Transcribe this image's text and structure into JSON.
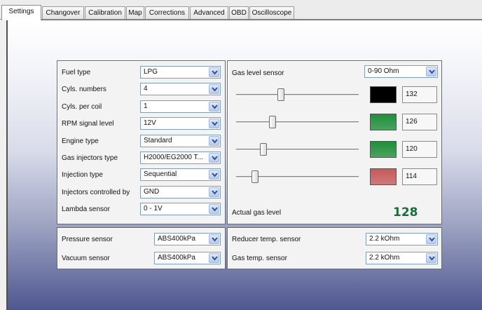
{
  "tabs": [
    "Settings",
    "Changover",
    "Calibration",
    "Map",
    "Corrections",
    "Advanced",
    "OBD",
    "Oscilloscope"
  ],
  "active_tab": "Settings",
  "settings": [
    {
      "label": "Fuel type",
      "value": "LPG"
    },
    {
      "label": "Cyls. numbers",
      "value": "4"
    },
    {
      "label": "Cyls. per coil",
      "value": "1"
    },
    {
      "label": "RPM signal level",
      "value": "12V"
    },
    {
      "label": "Engine type",
      "value": "Standard"
    },
    {
      "label": "Gas injectors type",
      "value": "H2000/EG2000 T..."
    },
    {
      "label": "Injection type",
      "value": "Sequential"
    },
    {
      "label": "Injectors controlled by",
      "value": "GND"
    },
    {
      "label": "Lambda sensor",
      "value": "0 - 1V"
    }
  ],
  "gas_level": {
    "label": "Gas level sensor",
    "range_value": "0-90 Ohm",
    "sliders": [
      {
        "value": 132,
        "color": "#000000"
      },
      {
        "value": 126,
        "color": "#1f8f3a"
      },
      {
        "value": 120,
        "color": "#1f8f3a"
      },
      {
        "value": 114,
        "color": "#c65a5a"
      }
    ],
    "actual_label": "Actual gas level",
    "actual_value": "128"
  },
  "pressure": [
    {
      "label": "Pressure sensor",
      "value": "ABS400kPa"
    },
    {
      "label": "Vacuum sensor",
      "value": "ABS400kPa"
    }
  ],
  "temperature": [
    {
      "label": "Reducer temp. sensor",
      "value": "2.2 kOhm"
    },
    {
      "label": "Gas temp. sensor",
      "value": "2.2 kOhm"
    }
  ],
  "icons": {
    "dropdown": "chevron-down-icon"
  }
}
